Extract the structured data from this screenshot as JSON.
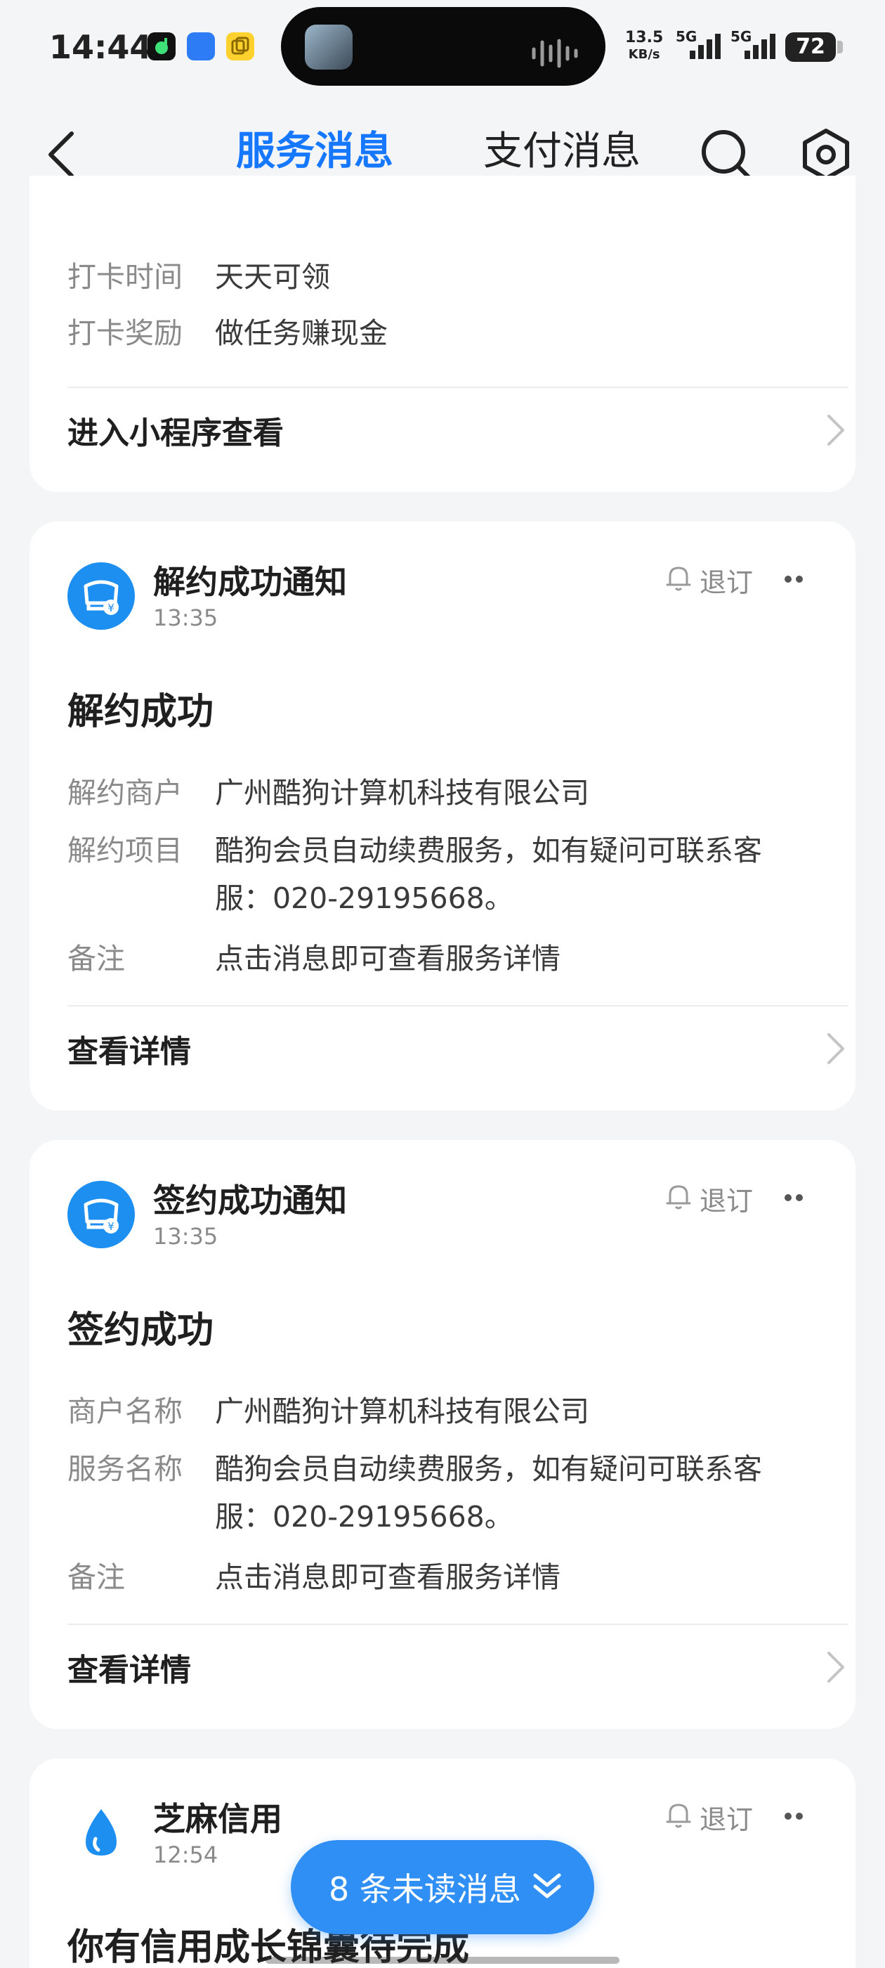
{
  "status_bar": {
    "time": "14:44",
    "net_speed_value": "13.5",
    "net_speed_unit": "KB/s",
    "signal1": "5G",
    "signal2": "5G",
    "battery": "72"
  },
  "header": {
    "tabs": [
      {
        "label": "服务消息",
        "active": true
      },
      {
        "label": "支付消息",
        "active": false
      }
    ],
    "accent_color": "#1677ff"
  },
  "card_top": {
    "rows": [
      {
        "label": "打卡时间",
        "value": "天天可领"
      },
      {
        "label": "打卡奖励",
        "value": "做任务赚现金"
      }
    ],
    "link": "进入小程序查看"
  },
  "card_cancel": {
    "name": "解约成功通知",
    "time": "13:35",
    "unsubscribe": "退订",
    "title": "解约成功",
    "rows": [
      {
        "label": "解约商户",
        "value": "广州酷狗计算机科技有限公司"
      },
      {
        "label": "解约项目",
        "value": "酷狗会员自动续费服务，如有疑问可联系客服：020-29195668。"
      },
      {
        "label": "备注",
        "value": "点击消息即可查看服务详情"
      }
    ],
    "link": "查看详情"
  },
  "card_sign": {
    "name": "签约成功通知",
    "time": "13:35",
    "unsubscribe": "退订",
    "title": "签约成功",
    "rows": [
      {
        "label": "商户名称",
        "value": "广州酷狗计算机科技有限公司"
      },
      {
        "label": "服务名称",
        "value": "酷狗会员自动续费服务，如有疑问可联系客服：020-29195668。"
      },
      {
        "label": "备注",
        "value": "点击消息即可查看服务详情"
      }
    ],
    "link": "查看详情"
  },
  "card_credit": {
    "name": "芝麻信用",
    "time": "12:54",
    "unsubscribe": "退订",
    "title": "你有信用成长锦囊待完成"
  },
  "unread_pill": {
    "label": "8 条未读消息",
    "color": "#2f8ff5"
  }
}
